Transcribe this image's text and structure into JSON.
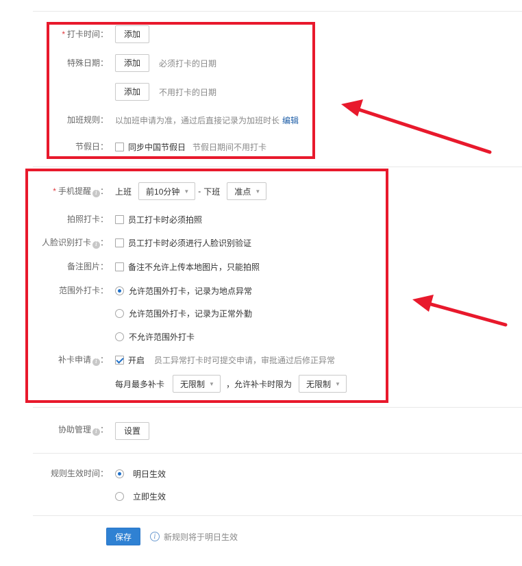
{
  "section1": {
    "punch_time": {
      "label": "打卡时间：",
      "required_mark": "*",
      "add_button": "添加"
    },
    "special_dates": {
      "label": "特殊日期：",
      "add_must": "添加",
      "hint_must": "必须打卡的日期",
      "add_not": "添加",
      "hint_not": "不用打卡的日期"
    },
    "overtime": {
      "label": "加班规则：",
      "text": "以加班申请为准，通过后直接记录为加班时长",
      "edit_link": "编辑"
    },
    "holiday": {
      "label": "节假日：",
      "checkbox_label": "同步中国节假日",
      "hint": "节假日期间不用打卡"
    }
  },
  "section2": {
    "phone_reminder": {
      "label": "手机提醒",
      "required_mark": "*",
      "work_on": "上班",
      "on_select": "前10分钟",
      "dash": "-",
      "work_off": "下班",
      "off_select": "准点"
    },
    "photo_punch": {
      "label": "拍照打卡：",
      "checkbox_label": "员工打卡时必须拍照"
    },
    "face_punch": {
      "label": "人脸识别打卡",
      "checkbox_label": "员工打卡时必须进行人脸识别验证"
    },
    "remark_image": {
      "label": "备注图片：",
      "checkbox_label": "备注不允许上传本地图片，只能拍照"
    },
    "out_of_range": {
      "label": "范围外打卡：",
      "options": [
        "允许范围外打卡，记录为地点异常",
        "允许范围外打卡，记录为正常外勤",
        "不允许范围外打卡"
      ],
      "selected_index": 0
    },
    "makeup": {
      "label": "补卡申请",
      "checkbox_label": "开启",
      "hint": "员工异常打卡时可提交申请，审批通过后修正异常",
      "monthly_label": "每月最多补卡",
      "monthly_select": "无限制",
      "limit_label": "，允许补卡时限为",
      "limit_select": "无限制"
    }
  },
  "assist": {
    "label": "协助管理",
    "button": "设置"
  },
  "effective": {
    "label": "规则生效时间：",
    "options": [
      "明日生效",
      "立即生效"
    ],
    "selected_index": 0
  },
  "footer": {
    "save_button": "保存",
    "note": "新规则将于明日生效"
  },
  "colors": {
    "highlight": "#e8192c",
    "primary": "#2f81d3",
    "link": "#1f5fa8",
    "required": "#e0393e"
  }
}
